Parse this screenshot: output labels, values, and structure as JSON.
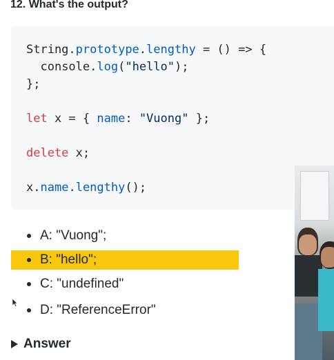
{
  "question": {
    "title": "12. What's the output?"
  },
  "code": {
    "line1": {
      "obj": "String",
      "dot1": ".",
      "proto": "prototype",
      "dot2": ".",
      "prop": "lengthy",
      "rest": " = () => {"
    },
    "line2": {
      "indent": "  ",
      "obj": "console",
      "dot": ".",
      "fn": "log",
      "open": "(",
      "str": "\"hello\"",
      "close": ");"
    },
    "line3": {
      "text": "};"
    },
    "line4": {
      "kw": "let",
      "mid": " x = { ",
      "key": "name",
      "colon": ": ",
      "str": "\"Vuong\"",
      "end": " };"
    },
    "line5": {
      "kw": "delete",
      "rest": " x;"
    },
    "line6": {
      "obj": "x",
      "dot1": ".",
      "name": "name",
      "dot2": ".",
      "fn": "lengthy",
      "rest": "();"
    }
  },
  "options": [
    {
      "label": "A: \"Vuong\";",
      "highlighted": false
    },
    {
      "label": "B: \"hello\";",
      "highlighted": true
    },
    {
      "label": "C: \"undefined\"",
      "highlighted": false
    },
    {
      "label": "D: \"ReferenceError\"",
      "highlighted": false
    }
  ],
  "answer": {
    "label": "Answer"
  },
  "colors": {
    "highlight": "#f9c80e",
    "code_bg": "#f6f8fa",
    "keyword": "#d73a49",
    "property": "#005cc5",
    "string": "#032f62"
  }
}
